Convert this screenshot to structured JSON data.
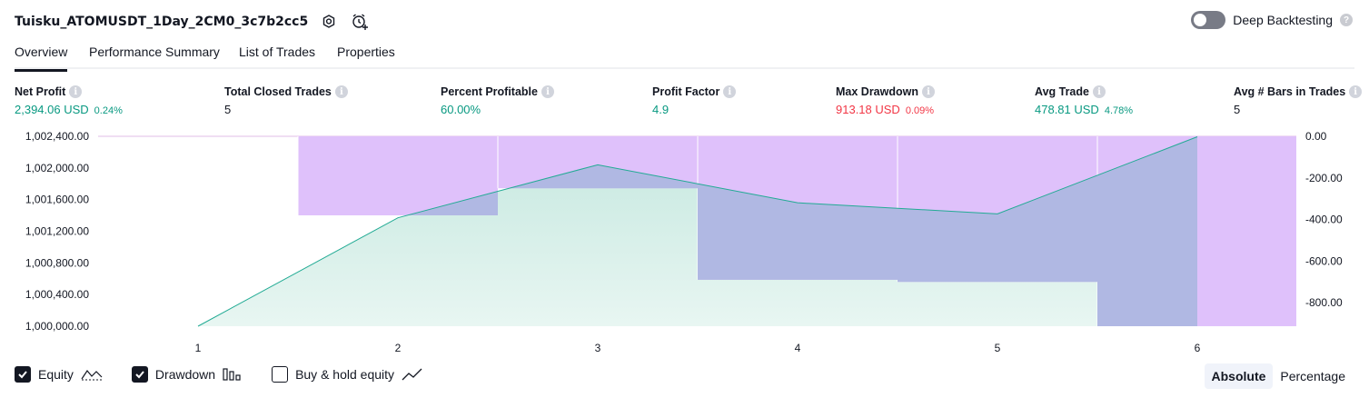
{
  "header": {
    "strategy_name": "Tuisku_ATOMUSDT_1Day_2CM0_3c7b2cc5",
    "settings_icon": "gear-icon",
    "alert_icon": "alarm-clock-plus-icon"
  },
  "deep_backtesting": {
    "label": "Deep Backtesting",
    "enabled": false,
    "help": "?"
  },
  "tabs": [
    {
      "label": "Overview",
      "active": true
    },
    {
      "label": "Performance Summary",
      "active": false
    },
    {
      "label": "List of Trades",
      "active": false
    },
    {
      "label": "Properties",
      "active": false
    }
  ],
  "metrics": [
    {
      "label": "Net Profit",
      "value": "2,394.06 USD",
      "sub": "0.24%",
      "tone": "pos"
    },
    {
      "label": "Total Closed Trades",
      "value": "5",
      "sub": "",
      "tone": "neutral"
    },
    {
      "label": "Percent Profitable",
      "value": "60.00%",
      "sub": "",
      "tone": "pos"
    },
    {
      "label": "Profit Factor",
      "value": "4.9",
      "sub": "",
      "tone": "pos"
    },
    {
      "label": "Max Drawdown",
      "value": "913.18 USD",
      "sub": "0.09%",
      "tone": "neg"
    },
    {
      "label": "Avg Trade",
      "value": "478.81 USD",
      "sub": "4.78%",
      "tone": "pos"
    },
    {
      "label": "Avg # Bars in Trades",
      "value": "5",
      "sub": "",
      "tone": "neutral"
    }
  ],
  "info_glyph": "i",
  "chart_data": {
    "type": "line",
    "x": [
      1,
      2,
      3,
      4,
      5,
      6
    ],
    "x_tick_labels": [
      "1",
      "2",
      "3",
      "4",
      "5",
      "6"
    ],
    "equity": {
      "name": "Equity",
      "values": [
        1000000,
        1001370,
        1002040,
        1001560,
        1001420,
        1002394
      ],
      "color": "#22ab94"
    },
    "drawdown": {
      "name": "Drawdown",
      "values": [
        0,
        -380,
        -250,
        -690,
        -700,
        -913
      ],
      "color": "#ce93d8"
    },
    "y_left": {
      "min": 1000000,
      "max": 1002400,
      "ticks": [
        1000000,
        1000400,
        1000800,
        1001200,
        1001600,
        1002000,
        1002400
      ],
      "tick_labels": [
        "1,000,000.00",
        "1,000,400.00",
        "1,000,800.00",
        "1,001,200.00",
        "1,001,600.00",
        "1,002,000.00",
        "1,002,400.00"
      ]
    },
    "y_right": {
      "min": -913.18,
      "max": 0,
      "ticks": [
        0,
        -200,
        -400,
        -600,
        -800
      ],
      "tick_labels": [
        "0.00",
        "-200.00",
        "-400.00",
        "-600.00",
        "-800.00"
      ]
    },
    "colors": {
      "equity_line": "#22ab94",
      "equity_fill_top": "#c5e8df",
      "equity_fill_bottom": "#e8f6f2",
      "drawdown_fill": "#dfc1fb",
      "overlap_fill": "#b0b8e3"
    }
  },
  "legend": [
    {
      "label": "Equity",
      "checked": true,
      "icon": "equity-line-icon"
    },
    {
      "label": "Drawdown",
      "checked": true,
      "icon": "drawdown-bars-icon"
    },
    {
      "label": "Buy & hold equity",
      "checked": false,
      "icon": "buy-hold-line-icon"
    }
  ],
  "view_mode": {
    "options": [
      "Absolute",
      "Percentage"
    ],
    "selected": "Absolute"
  }
}
